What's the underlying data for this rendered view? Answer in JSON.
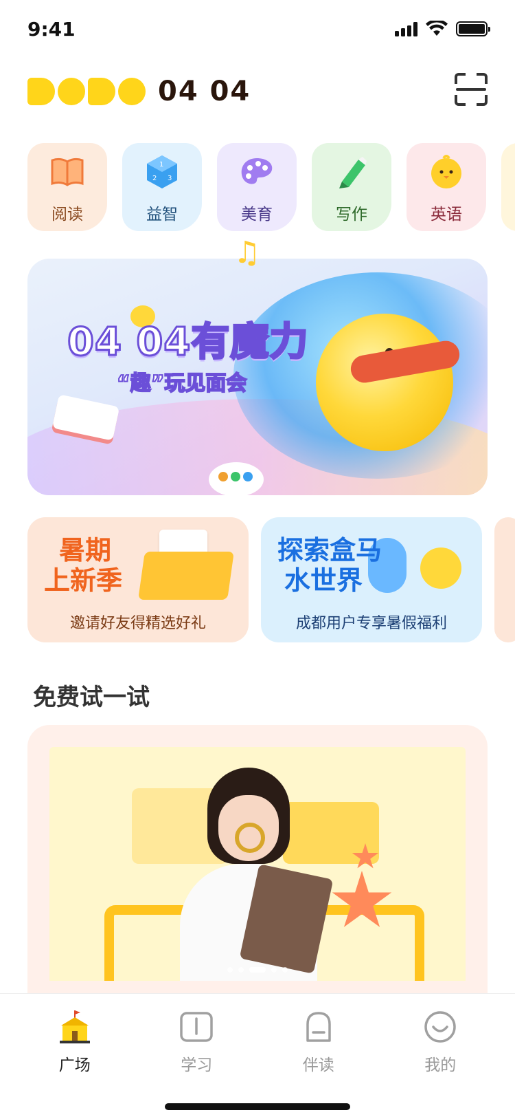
{
  "status_bar": {
    "time": "9:41"
  },
  "header": {
    "logo_text": "04 04",
    "brand_color": "#FFD51A"
  },
  "categories": [
    {
      "label": "阅读",
      "icon": "book-icon",
      "bg": "#FDEBDD",
      "color": "#8a4a20"
    },
    {
      "label": "益智",
      "icon": "dice-icon",
      "bg": "#E2F2FD",
      "color": "#1f4f7a"
    },
    {
      "label": "美育",
      "icon": "palette-icon",
      "bg": "#EEE9FD",
      "color": "#4a3a8a"
    },
    {
      "label": "写作",
      "icon": "pen-icon",
      "bg": "#E4F6E2",
      "color": "#2e6a2a"
    },
    {
      "label": "英语",
      "icon": "chick-icon",
      "bg": "#FDE8EA",
      "color": "#8a2a3a"
    },
    {
      "label": "",
      "icon": "more-icon",
      "bg": "#FFF6DC",
      "color": "#8a6a20"
    }
  ],
  "banner": {
    "title": "04 04有魔力",
    "subtitle": "“趣”玩见面会"
  },
  "promos": [
    {
      "title_line1": "暑期",
      "title_line2": "上新季",
      "subtitle": "邀请好友得精选好礼"
    },
    {
      "title_line1": "探索盒马",
      "title_line2": "水世界",
      "subtitle": "成都用户专享暑假福利"
    }
  ],
  "section": {
    "title": "免费试一试"
  },
  "tab_bar": {
    "tabs": [
      {
        "label": "广场",
        "icon": "school-icon",
        "active": true
      },
      {
        "label": "学习",
        "icon": "book-icon",
        "active": false
      },
      {
        "label": "伴读",
        "icon": "backpack-icon",
        "active": false
      },
      {
        "label": "我的",
        "icon": "smile-icon",
        "active": false
      }
    ]
  }
}
